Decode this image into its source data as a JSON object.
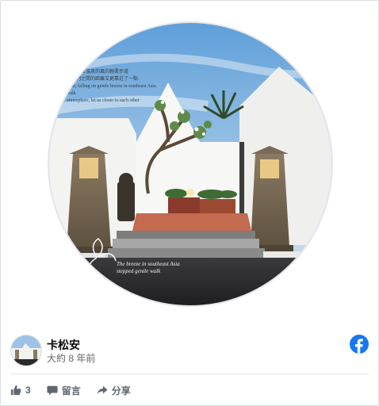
{
  "photo": {
    "caption_top_lines": [
      "在卡松安溫泉的風的輕柔步道",
      "讓我們之間的距離又更靠近了一點",
      "light, falling on gentle breeze in southeast Asia",
      "walk",
      "atmosphere, let us closer to each other"
    ],
    "caption_bottom_lines": [
      "The breeze in southeast Asia",
      "stepped gentle walk"
    ]
  },
  "post": {
    "author": "卡松安",
    "time": "大約 8 年前"
  },
  "actions": {
    "like_count": "3",
    "comment_label": "留言",
    "share_label": "分享"
  },
  "colors": {
    "facebook_blue": "#1877f2",
    "action_gray": "#606770"
  },
  "icons": [
    "facebook-icon",
    "thumbs-up-icon",
    "comment-icon",
    "share-icon"
  ]
}
